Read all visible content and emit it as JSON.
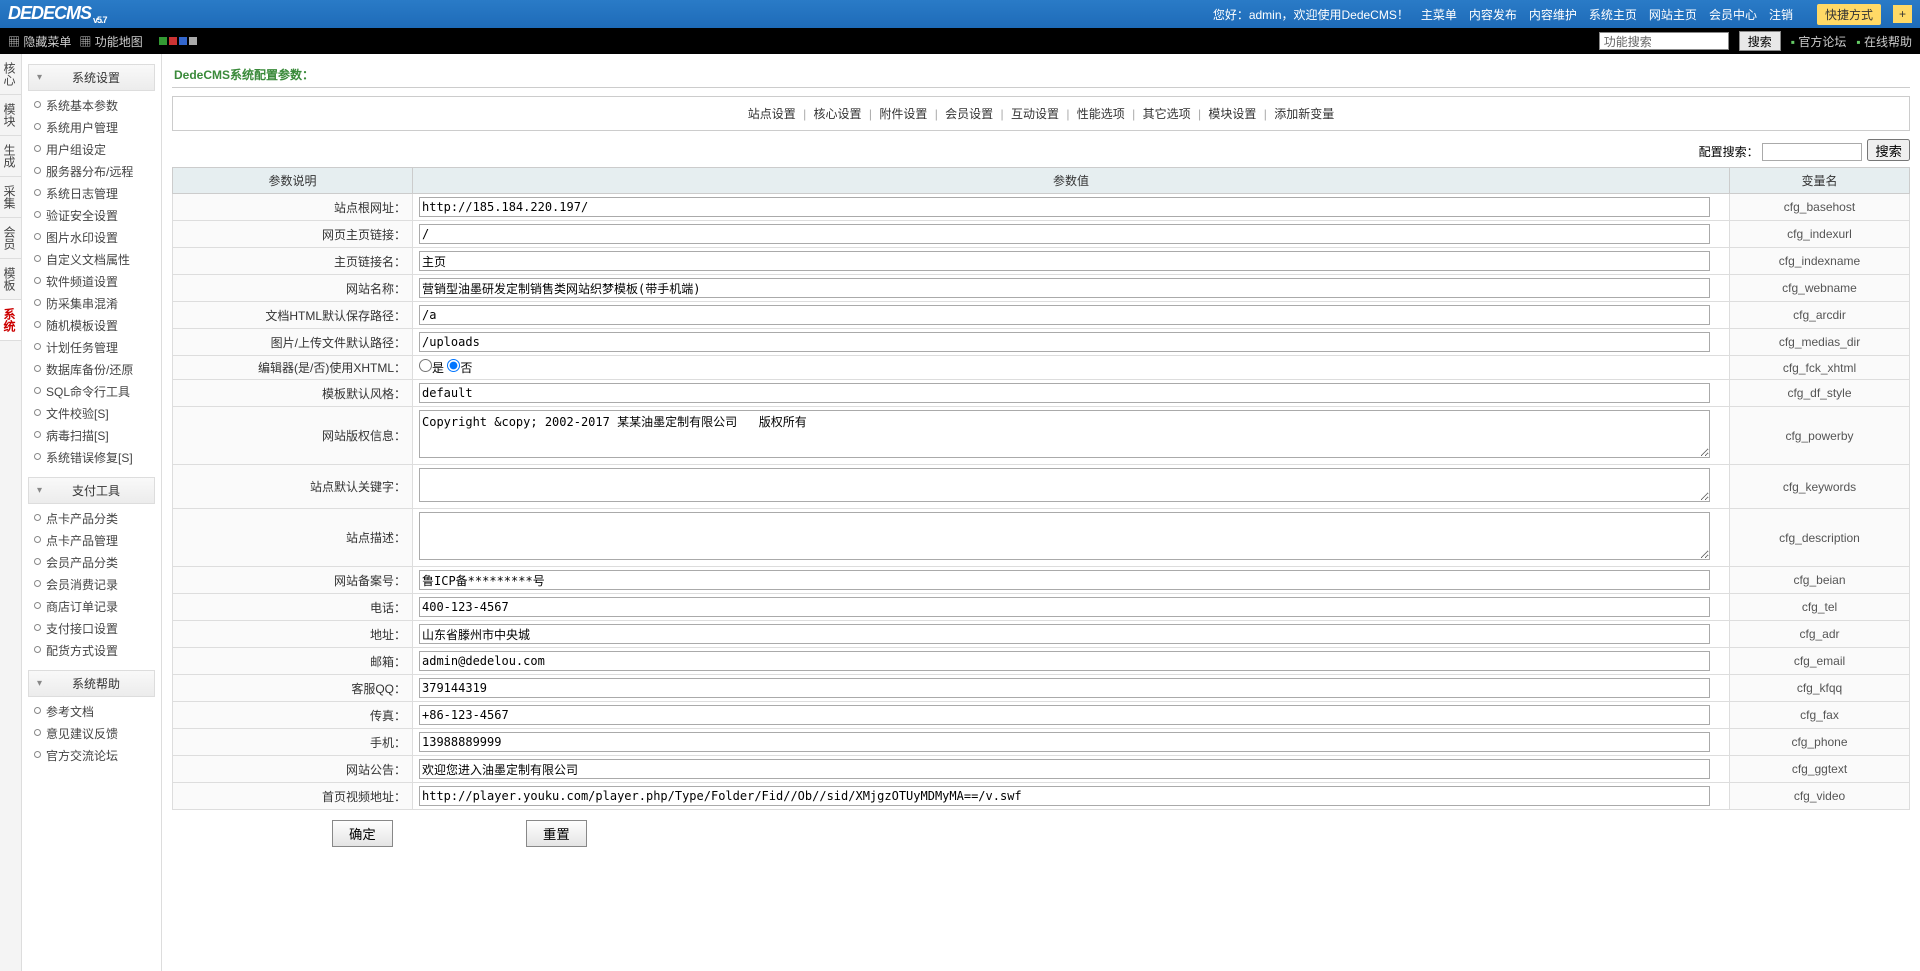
{
  "top": {
    "logo": "DEDECMS",
    "version": "v5.7",
    "greeting": "您好：admin，欢迎使用DedeCMS！",
    "menu": [
      "主菜单",
      "内容发布",
      "内容维护",
      "系统主页",
      "网站主页",
      "会员中心",
      "注销"
    ],
    "quick": "快捷方式",
    "plus": "+"
  },
  "blackbar": {
    "hide_menu": "隐藏菜单",
    "fn_map": "功能地图",
    "search_value": "功能搜索",
    "search_btn": "搜索",
    "forum": "官方论坛",
    "help": "在线帮助"
  },
  "vtabs": [
    "核心",
    "模块",
    "生成",
    "采集",
    "会员",
    "模板",
    "系统"
  ],
  "active_vtab": 6,
  "side_sections": [
    {
      "title": "系统设置",
      "items": [
        "系统基本参数",
        "系统用户管理",
        "用户组设定",
        "服务器分布/远程",
        "系统日志管理",
        "验证安全设置",
        "图片水印设置",
        "自定义文档属性",
        "软件频道设置",
        "防采集串混淆",
        "随机模板设置",
        "计划任务管理",
        "数据库备份/还原",
        "SQL命令行工具",
        "文件校验[S]",
        "病毒扫描[S]",
        "系统错误修复[S]"
      ]
    },
    {
      "title": "支付工具",
      "items": [
        "点卡产品分类",
        "点卡产品管理",
        "会员产品分类",
        "会员消费记录",
        "商店订单记录",
        "支付接口设置",
        "配货方式设置"
      ]
    },
    {
      "title": "系统帮助",
      "items": [
        "参考文档",
        "意见建议反馈",
        "官方交流论坛"
      ]
    }
  ],
  "panel_title": "DedeCMS系统配置参数：",
  "tabnav": [
    "站点设置",
    "核心设置",
    "附件设置",
    "会员设置",
    "互动设置",
    "性能选项",
    "其它选项",
    "模块设置",
    "添加新变量"
  ],
  "config_search": {
    "label": "配置搜索：",
    "btn": "搜索"
  },
  "headers": {
    "desc": "参数说明",
    "val": "参数值",
    "var": "变量名"
  },
  "rows": [
    {
      "label": "站点根网址：",
      "type": "text",
      "value": "http://185.184.220.197/",
      "var": "cfg_basehost"
    },
    {
      "label": "网页主页链接：",
      "type": "text",
      "value": "/",
      "var": "cfg_indexurl"
    },
    {
      "label": "主页链接名：",
      "type": "text",
      "value": "主页",
      "var": "cfg_indexname"
    },
    {
      "label": "网站名称：",
      "type": "text",
      "value": "营销型油墨研发定制销售类网站织梦模板(带手机端)",
      "var": "cfg_webname"
    },
    {
      "label": "文档HTML默认保存路径：",
      "type": "text",
      "value": "/a",
      "var": "cfg_arcdir"
    },
    {
      "label": "图片/上传文件默认路径：",
      "type": "text",
      "value": "/uploads",
      "var": "cfg_medias_dir"
    },
    {
      "label": "编辑器(是/否)使用XHTML：",
      "type": "radio",
      "yes": "是",
      "no": "否",
      "var": "cfg_fck_xhtml"
    },
    {
      "label": "模板默认风格：",
      "type": "text",
      "value": "default",
      "var": "cfg_df_style"
    },
    {
      "label": "网站版权信息：",
      "type": "textarea",
      "value": "Copyright &copy; 2002-2017 某某油墨定制有限公司   版权所有",
      "rows": 3,
      "var": "cfg_powerby"
    },
    {
      "label": "站点默认关键字：",
      "type": "textarea",
      "value": "",
      "rows": 2,
      "var": "cfg_keywords"
    },
    {
      "label": "站点描述：",
      "type": "textarea",
      "value": "",
      "rows": 3,
      "var": "cfg_description"
    },
    {
      "label": "网站备案号：",
      "type": "text",
      "value": "鲁ICP备*********号",
      "var": "cfg_beian"
    },
    {
      "label": "电话：",
      "type": "text",
      "value": "400-123-4567",
      "var": "cfg_tel"
    },
    {
      "label": "地址：",
      "type": "text",
      "value": "山东省滕州市中央城",
      "var": "cfg_adr"
    },
    {
      "label": "邮箱：",
      "type": "text",
      "value": "admin@dedelou.com",
      "var": "cfg_email"
    },
    {
      "label": "客服QQ：",
      "type": "text",
      "value": "379144319",
      "var": "cfg_kfqq"
    },
    {
      "label": "传真：",
      "type": "text",
      "value": "+86-123-4567",
      "var": "cfg_fax"
    },
    {
      "label": "手机：",
      "type": "text",
      "value": "13988889999",
      "var": "cfg_phone"
    },
    {
      "label": "网站公告：",
      "type": "text",
      "value": "欢迎您进入油墨定制有限公司",
      "var": "cfg_ggtext"
    },
    {
      "label": "首页视频地址：",
      "type": "text",
      "value": "http://player.youku.com/player.php/Type/Folder/Fid//Ob//sid/XMjgzOTUyMDMyMA==/v.swf",
      "var": "cfg_video"
    }
  ],
  "buttons": {
    "ok": "确定",
    "reset": "重置"
  }
}
